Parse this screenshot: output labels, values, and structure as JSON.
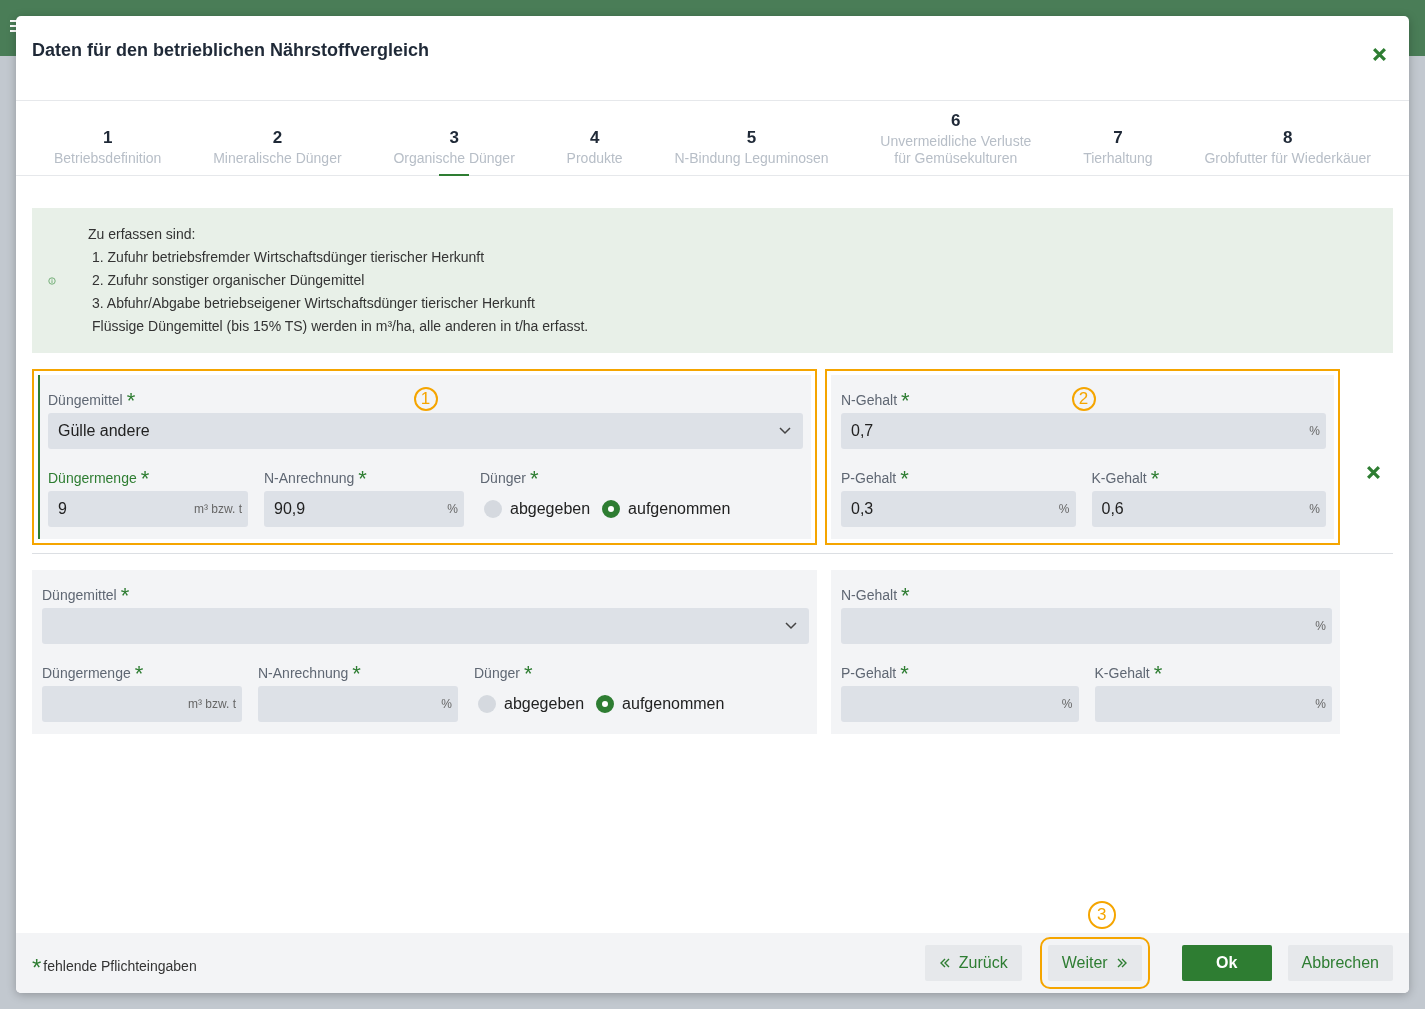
{
  "window": {
    "title": "Daten für den betrieblichen Nährstoffvergleich"
  },
  "steps": [
    {
      "number": "1",
      "label": "Betriebsdefinition",
      "selected": false
    },
    {
      "number": "2",
      "label": "Mineralische Dünger",
      "selected": false
    },
    {
      "number": "3",
      "label": "Organische Dünger",
      "selected": true
    },
    {
      "number": "4",
      "label": "Produkte",
      "selected": false
    },
    {
      "number": "5",
      "label": "N-Bindung Leguminosen",
      "selected": false
    },
    {
      "number": "6",
      "label": "Unvermeidliche Verluste\nfür Gemüsekulturen",
      "selected": false
    },
    {
      "number": "7",
      "label": "Tierhaltung",
      "selected": false
    },
    {
      "number": "8",
      "label": "Grobfutter für Wiederkäuer",
      "selected": false
    }
  ],
  "info": {
    "lines": [
      "Zu erfassen sind:",
      "1. Zufuhr betriebsfremder Wirtschaftsdünger tierischer Herkunft",
      "2. Zufuhr sonstiger organischer Düngemittel",
      "3. Abfuhr/Abgabe betriebseigener Wirtschaftsdünger tierischer Herkunft",
      "Flüssige Düngemittel (bis 15% TS) werden in m³/ha, alle anderen in t/ha erfasst."
    ]
  },
  "entries": [
    {
      "active": true,
      "removable": true,
      "callouts": [
        "1",
        "2"
      ],
      "fertilizer": {
        "label": "Düngemittel",
        "mark": "*",
        "value": "Gülle andere"
      },
      "amount": {
        "label": "Düngermenge",
        "mark": "*",
        "value": "9",
        "unit": "m³ bzw. t",
        "focused": true
      },
      "n_credit": {
        "label": "N-Anrechnung",
        "mark": "*",
        "value": "90,9",
        "unit": "%"
      },
      "direction": {
        "label": "Dünger",
        "mark": "*",
        "options": [
          {
            "label": "abgegeben",
            "selected": false
          },
          {
            "label": "aufgenommen",
            "selected": true
          }
        ]
      },
      "n": {
        "label": "N-Gehalt",
        "mark": "*",
        "value": "0,7",
        "unit": "%"
      },
      "p": {
        "label": "P-Gehalt",
        "mark": "*",
        "value": "0,3",
        "unit": "%"
      },
      "k": {
        "label": "K-Gehalt",
        "mark": "*",
        "value": "0,6",
        "unit": "%"
      }
    },
    {
      "active": false,
      "removable": false,
      "fertilizer": {
        "label": "Düngemittel",
        "mark": "*"
      },
      "amount": {
        "label": "Düngermenge",
        "mark": "*",
        "unit": "m³ bzw. t",
        "focused": false
      },
      "n_credit": {
        "label": "N-Anrechnung",
        "mark": "*",
        "unit": "%"
      },
      "direction": {
        "label": "Dünger",
        "mark": "*",
        "options": [
          {
            "label": "abgegeben",
            "selected": false
          },
          {
            "label": "aufgenommen",
            "selected": true
          }
        ]
      },
      "n": {
        "label": "N-Gehalt",
        "mark": "*",
        "unit": "%"
      },
      "p": {
        "label": "P-Gehalt",
        "mark": "*",
        "unit": "%"
      },
      "k": {
        "label": "K-Gehalt",
        "mark": "*",
        "unit": "%"
      }
    }
  ],
  "footer": {
    "mark": "*",
    "legend": "fehlende Pflichteingaben",
    "buttons": [
      {
        "label": "Zurück",
        "kind": "back"
      },
      {
        "label": "Weiter",
        "kind": "next",
        "callout": "3"
      },
      {
        "label": "Ok",
        "kind": "primary"
      },
      {
        "label": "Abbrechen",
        "kind": "cancel"
      }
    ]
  }
}
